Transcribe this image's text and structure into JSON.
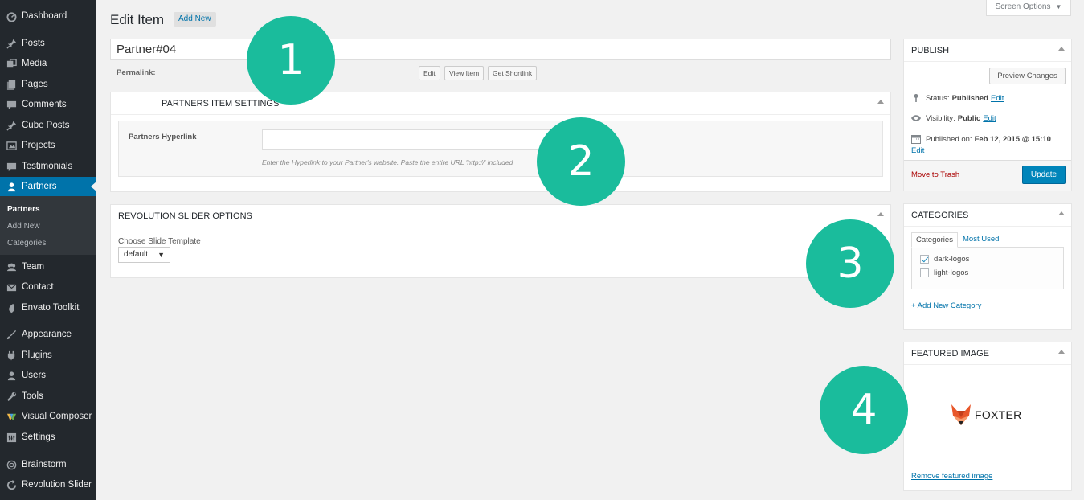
{
  "sidebar": {
    "items": [
      {
        "label": "Dashboard",
        "icon": "dashboard-icon"
      },
      {
        "label": "Posts",
        "icon": "pin-icon"
      },
      {
        "label": "Media",
        "icon": "media-icon"
      },
      {
        "label": "Pages",
        "icon": "pages-icon"
      },
      {
        "label": "Comments",
        "icon": "comment-icon"
      },
      {
        "label": "Cube Posts",
        "icon": "pin-icon"
      },
      {
        "label": "Projects",
        "icon": "image-icon"
      },
      {
        "label": "Testimonials",
        "icon": "comment-icon"
      },
      {
        "label": "Partners",
        "icon": "user-icon"
      },
      {
        "label": "Team",
        "icon": "groups-icon"
      },
      {
        "label": "Contact",
        "icon": "mail-icon"
      },
      {
        "label": "Envato Toolkit",
        "icon": "leaf-icon"
      },
      {
        "label": "Appearance",
        "icon": "brush-icon"
      },
      {
        "label": "Plugins",
        "icon": "plugin-icon"
      },
      {
        "label": "Users",
        "icon": "user-icon"
      },
      {
        "label": "Tools",
        "icon": "wrench-icon"
      },
      {
        "label": "Visual Composer",
        "icon": "vc-icon"
      },
      {
        "label": "Settings",
        "icon": "settings-icon"
      },
      {
        "label": "Brainstorm",
        "icon": "brain-icon"
      },
      {
        "label": "Revolution Slider",
        "icon": "refresh-icon"
      }
    ],
    "submenu": [
      "Partners",
      "Add New",
      "Categories"
    ]
  },
  "header": {
    "title": "Edit Item",
    "add_new": "Add New",
    "screen_options": "Screen Options"
  },
  "post": {
    "title_value": "Partner#04",
    "permalink_label": "Permalink:",
    "edit_btn": "Edit",
    "view_btn": "View Item",
    "shortlink_btn": "Get Shortlink"
  },
  "partners_settings": {
    "title": "PARTNERS ITEM SETTINGS",
    "hyperlink_label": "Partners Hyperlink",
    "hyperlink_value": "",
    "hyperlink_desc": "Enter the Hyperlink to your Partner's website. Paste the entire URL 'http://' included"
  },
  "revslider": {
    "title": "REVOLUTION SLIDER OPTIONS",
    "template_label": "Choose Slide Template",
    "template_value": "default"
  },
  "publish": {
    "title": "PUBLISH",
    "preview_btn": "Preview Changes",
    "status_label": "Status:",
    "status_value": "Published",
    "visibility_label": "Visibility:",
    "visibility_value": "Public",
    "published_label": "Published on:",
    "published_value": "Feb 12, 2015 @ 15:10",
    "edit_link": "Edit",
    "trash": "Move to Trash",
    "update": "Update"
  },
  "categories": {
    "title": "CATEGORIES",
    "tab_all": "Categories",
    "tab_used": "Most Used",
    "items": [
      {
        "label": "dark-logos",
        "checked": true
      },
      {
        "label": "light-logos",
        "checked": false
      }
    ],
    "add_new": "+ Add New Category"
  },
  "featured": {
    "title": "FEATURED IMAGE",
    "logo_text": "FOXTER",
    "remove": "Remove featured image"
  },
  "callouts": [
    "1",
    "2",
    "3",
    "4"
  ],
  "colors": {
    "sidebar_bg": "#23282d",
    "active_blue": "#0073aa",
    "callout_green": "#1abc9c",
    "fox_orange": "#e8572a"
  }
}
